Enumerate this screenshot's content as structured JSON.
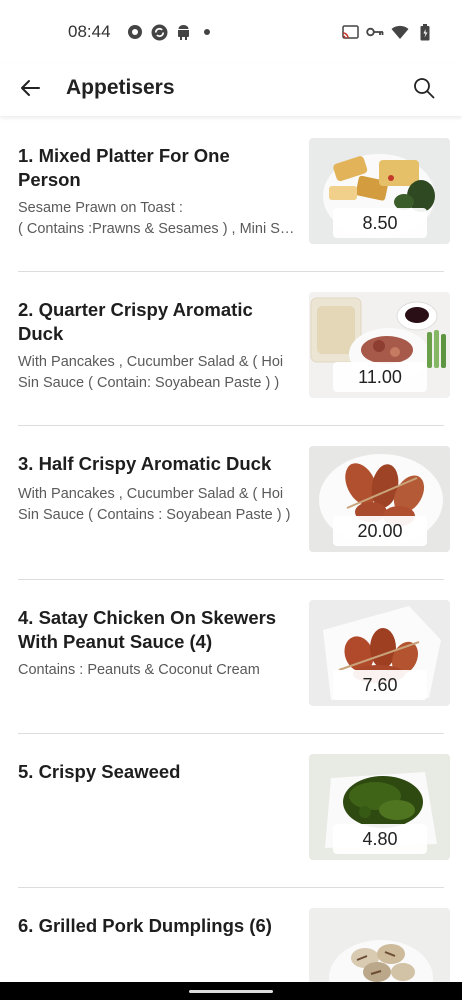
{
  "status_bar": {
    "time": "08:44"
  },
  "app_bar": {
    "title": "Appetisers"
  },
  "colors": {
    "background": "#ffffff",
    "text": "#222222",
    "muted": "#5a5a5a",
    "divider": "#dddddd"
  },
  "items": [
    {
      "title_line1": "1. Mixed Platter For One",
      "title_line2": "Person",
      "desc_line1": "Sesame Prawn on Toast :",
      "desc_line2": "( Contains :Prawns & Sesames ) , Mini S…",
      "price": "8.50"
    },
    {
      "title_line1": "2. Quarter Crispy Aromatic",
      "title_line2": "Duck",
      "desc_line1": "With Pancakes , Cucumber Salad & ( Hoi",
      "desc_line2": "Sin Sauce ( Contain:  Soyabean Paste ) )",
      "price": "11.00"
    },
    {
      "title_line1": "3. Half Crispy Aromatic Duck",
      "title_line2": "",
      "desc_line1": "With Pancakes , Cucumber Salad & ( Hoi",
      "desc_line2": "Sin Sauce ( Contains : Soyabean Paste ) )",
      "price": "20.00"
    },
    {
      "title_line1": "4. Satay Chicken On Skewers",
      "title_line2": "With Peanut Sauce (4)",
      "desc_line1": "Contains : Peanuts & Coconut Cream",
      "desc_line2": "",
      "price": "7.60"
    },
    {
      "title_line1": "5. Crispy Seaweed",
      "title_line2": "",
      "desc_line1": "",
      "desc_line2": "",
      "price": "4.80"
    },
    {
      "title_line1": "6. Grilled Pork Dumplings (6)",
      "title_line2": "",
      "desc_line1": "",
      "desc_line2": "",
      "price": ""
    }
  ]
}
